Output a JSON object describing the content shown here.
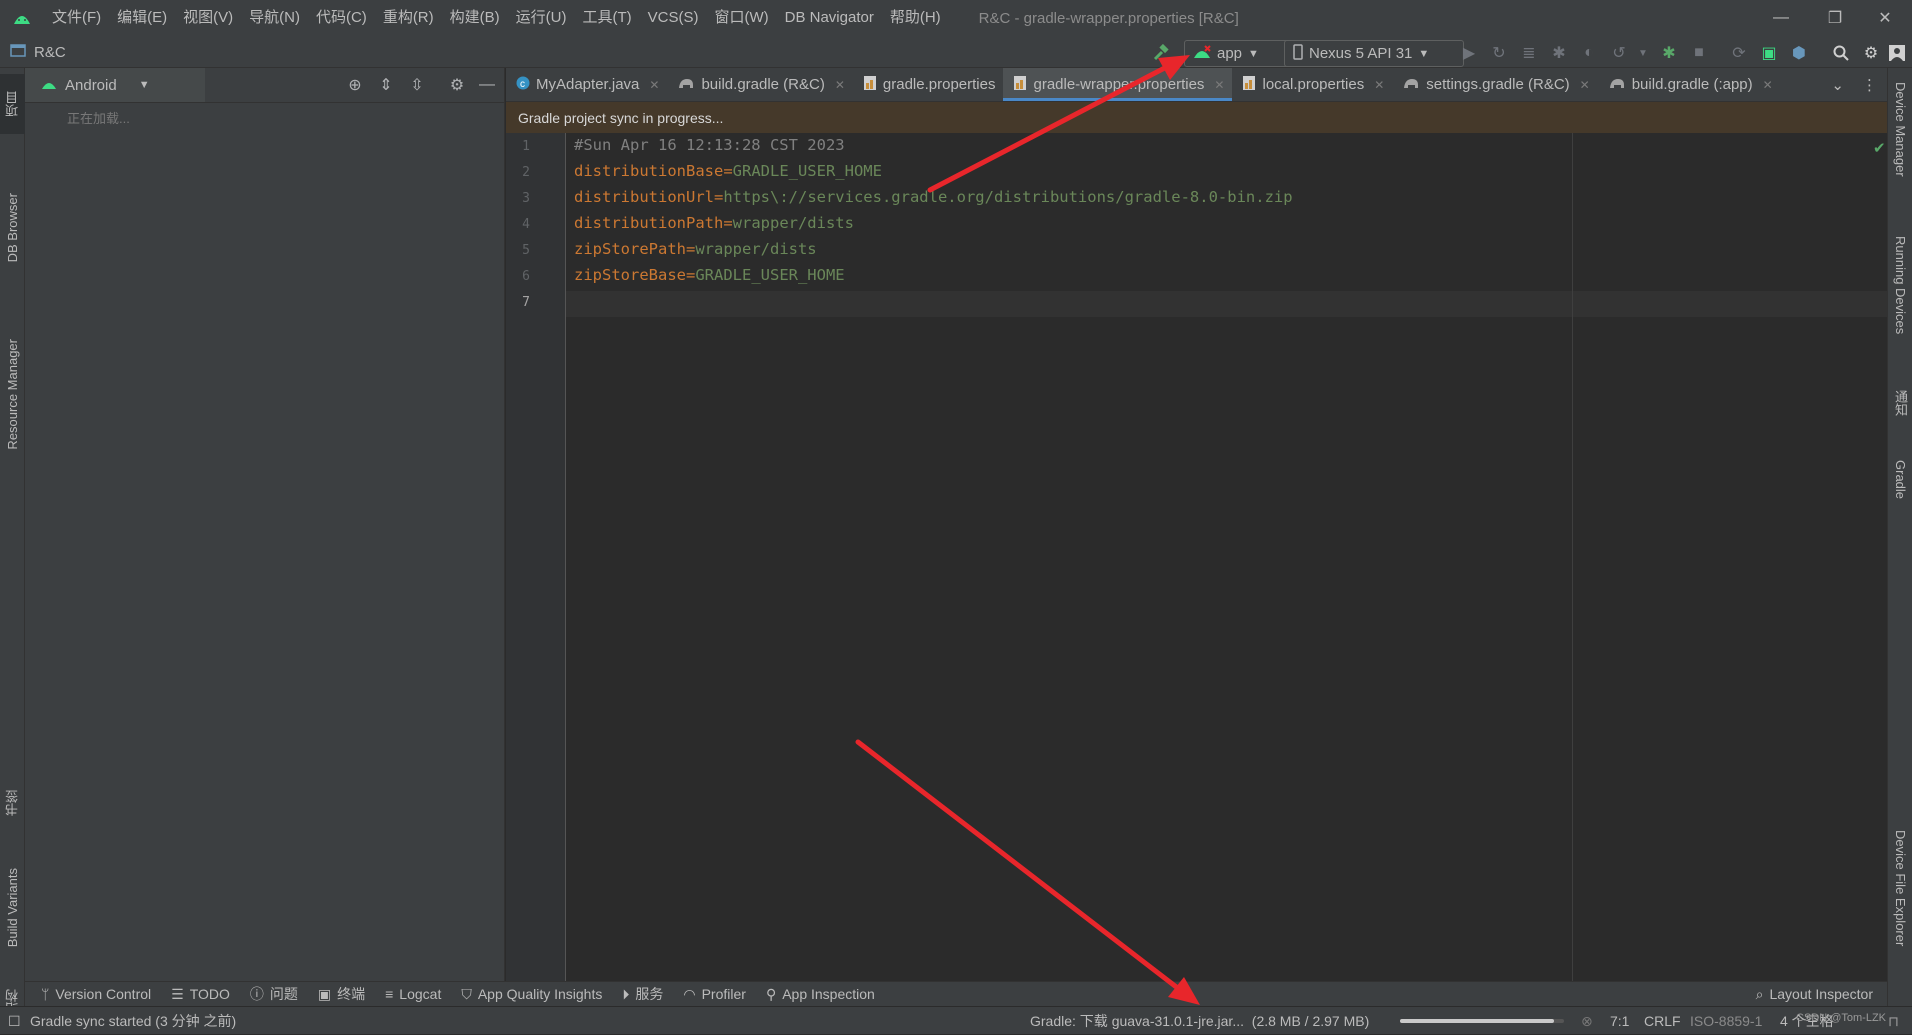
{
  "window": {
    "title": "R&C - gradle-wrapper.properties [R&C]",
    "menu": [
      "文件(F)",
      "编辑(E)",
      "视图(V)",
      "导航(N)",
      "代码(C)",
      "重构(R)",
      "构建(B)",
      "运行(U)",
      "工具(T)",
      "VCS(S)",
      "窗口(W)",
      "DB Navigator",
      "帮助(H)"
    ],
    "controls": {
      "minimize": "—",
      "restore": "❐",
      "close": "✕"
    }
  },
  "navbar": {
    "project": "R&C",
    "run_config": "app",
    "device": "Nexus 5 API 31"
  },
  "left_strip": {
    "tabs": [
      "项目",
      "DB Browser",
      "Resource Manager",
      "书签",
      "Build Variants",
      "结构"
    ]
  },
  "right_strip": {
    "tabs": [
      "Device Manager",
      "Running Devices",
      "通知",
      "Gradle",
      "Device File Explorer"
    ]
  },
  "project_panel": {
    "view_selector": "Android",
    "loading_text": "正在加载..."
  },
  "editor": {
    "tabs": [
      {
        "label": "MyAdapter.java",
        "icon": "java-class-icon",
        "active": false
      },
      {
        "label": "build.gradle (R&C)",
        "icon": "gradle-elephant-icon",
        "active": false
      },
      {
        "label": "gradle.properties",
        "icon": "properties-file-icon",
        "active": false
      },
      {
        "label": "gradle-wrapper.properties",
        "icon": "properties-file-icon",
        "active": true
      },
      {
        "label": "local.properties",
        "icon": "properties-file-icon",
        "active": false
      },
      {
        "label": "settings.gradle (R&C)",
        "icon": "gradle-elephant-icon",
        "active": false
      },
      {
        "label": "build.gradle (:app)",
        "icon": "gradle-elephant-icon",
        "active": false
      }
    ],
    "banner": "Gradle project sync in progress...",
    "line_numbers": [
      "1",
      "2",
      "3",
      "4",
      "5",
      "6",
      "7"
    ],
    "lines": [
      {
        "comment": "#Sun Apr 16 12:13:28 CST 2023"
      },
      {
        "key": "distributionBase",
        "eq": "=",
        "value": "GRADLE_USER_HOME"
      },
      {
        "key": "distributionUrl",
        "eq": "=",
        "value": "https\\://services.gradle.org/distributions/gradle-8.0-bin.zip"
      },
      {
        "key": "distributionPath",
        "eq": "=",
        "value": "wrapper/dists"
      },
      {
        "key": "zipStorePath",
        "eq": "=",
        "value": "wrapper/dists"
      },
      {
        "key": "zipStoreBase",
        "eq": "=",
        "value": "GRADLE_USER_HOME"
      }
    ],
    "colors": {
      "key": "#cc7832",
      "value": "#6a8759",
      "comment": "#808080"
    }
  },
  "bottom_tools": {
    "tabs": [
      {
        "label": "Version Control",
        "icon": "branch-icon"
      },
      {
        "label": "TODO",
        "icon": "list-icon"
      },
      {
        "label": "问题",
        "icon": "info-icon"
      },
      {
        "label": "终端",
        "icon": "terminal-icon"
      },
      {
        "label": "Logcat",
        "icon": "logcat-icon"
      },
      {
        "label": "App Quality Insights",
        "icon": "shield-icon"
      },
      {
        "label": "服务",
        "icon": "play-circle-icon"
      },
      {
        "label": "Profiler",
        "icon": "gauge-icon"
      },
      {
        "label": "App Inspection",
        "icon": "android-icon"
      }
    ],
    "layout_inspector": "Layout Inspector"
  },
  "status": {
    "message": "Gradle sync started (3 分钟 之前)",
    "gradle_task": "Gradle: 下载 guava-31.0.1-jre.jar...",
    "gradle_size": "(2.8 MB / 2.97 MB)",
    "progress": 0.94,
    "caret": "7:1",
    "line_sep": "CRLF",
    "encoding": "ISO-8859-1",
    "indent": "4 个空格",
    "watermark": "CSDN @Tom-LZK"
  },
  "colors": {
    "accent": "#4a88c7",
    "arrow": "#e8262b",
    "android_green": "#3ddc84"
  }
}
